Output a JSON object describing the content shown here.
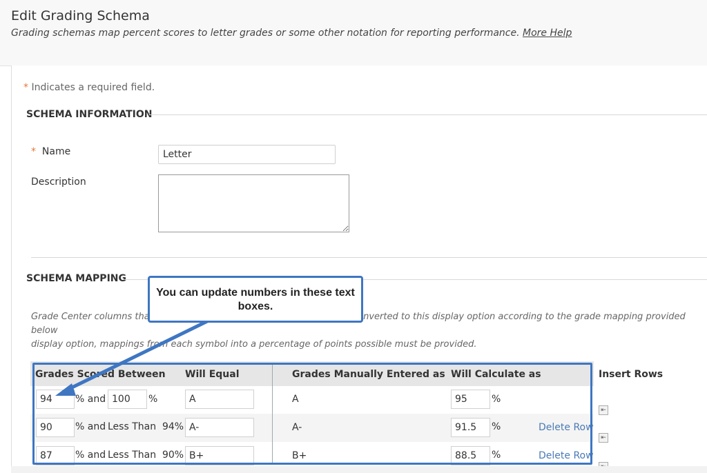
{
  "header": {
    "title": "Edit Grading Schema",
    "subtitle": "Grading schemas map percent scores to letter grades or some other notation for reporting performance.",
    "more_help": "More Help"
  },
  "required_note": {
    "star": "*",
    "text": "Indicates a required field."
  },
  "schema_information": {
    "title": "SCHEMA INFORMATION",
    "name_label": "Name",
    "name_value": "Letter",
    "description_label": "Description",
    "description_value": ""
  },
  "schema_mapping": {
    "title": "SCHEMA MAPPING",
    "description_line1": "Grade Center columns that",
    "description_line1_end": "nverted to this display option according to the grade mapping provided below",
    "description_line2": "display option, mappings from each symbol into a percentage of points possible must be provided.",
    "callout": "You can update numbers in these text boxes.",
    "columns": {
      "scored_between": "Grades Scored Between",
      "will_equal": "Will Equal",
      "manually_entered": "Grades Manually Entered as",
      "will_calculate": "Will Calculate as",
      "insert_rows": "Insert Rows"
    },
    "rows": [
      {
        "low": "94",
        "and_label": "% and",
        "high": "100",
        "high_suffix": "%",
        "less_than": "",
        "equal": "A",
        "manual": "A",
        "calc": "95",
        "calc_suffix": "%",
        "delete": ""
      },
      {
        "low": "90",
        "and_label": "% and",
        "high": "",
        "high_suffix": "",
        "less_than": "Less Than  94%",
        "equal": "A-",
        "manual": "A-",
        "calc": "91.5",
        "calc_suffix": "%",
        "delete": "Delete Row"
      },
      {
        "low": "87",
        "and_label": "% and",
        "high": "",
        "high_suffix": "",
        "less_than": "Less Than  90%",
        "equal": "B+",
        "manual": "B+",
        "calc": "88.5",
        "calc_suffix": "%",
        "delete": "Delete Row"
      }
    ]
  },
  "icons": {
    "insert_row": "insert-row-icon"
  },
  "colors": {
    "accent": "#3e76c2",
    "required": "#e07a3b",
    "link": "#4a7ab5"
  }
}
